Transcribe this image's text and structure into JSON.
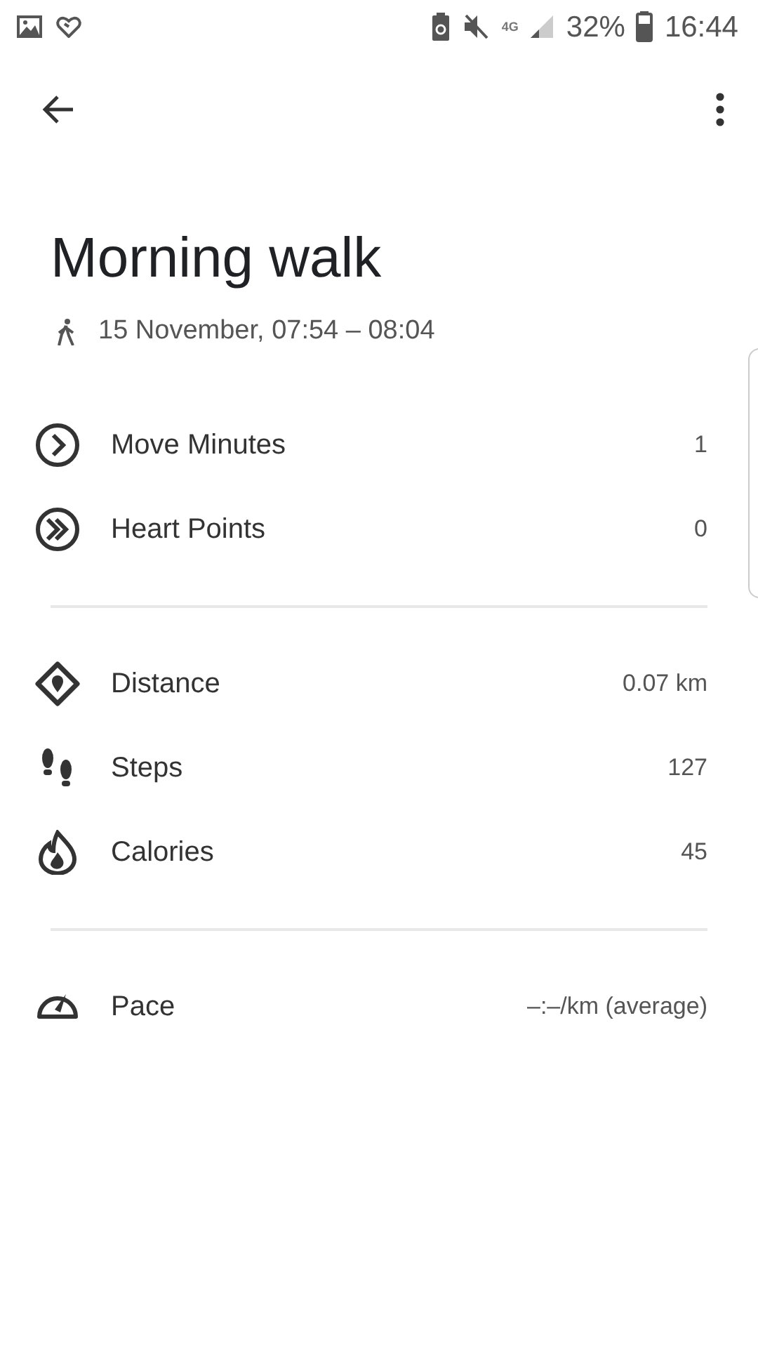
{
  "status_bar": {
    "network": "4G",
    "battery_percent": "32%",
    "time": "16:44"
  },
  "title": "Morning walk",
  "subtitle": {
    "kind": "walk",
    "text": "15 November, 07:54 – 08:04"
  },
  "sections": [
    {
      "rows": [
        {
          "kind": "move",
          "label": "Move Minutes",
          "value": "1"
        },
        {
          "kind": "heart",
          "label": "Heart Points",
          "value": "0"
        }
      ]
    },
    {
      "rows": [
        {
          "kind": "distance",
          "label": "Distance",
          "value": "0.07 km"
        },
        {
          "kind": "steps",
          "label": "Steps",
          "value": "127"
        },
        {
          "kind": "calories",
          "label": "Calories",
          "value": "45"
        }
      ]
    },
    {
      "rows": [
        {
          "kind": "pace",
          "label": "Pace",
          "value": "–:–/km (average)"
        }
      ]
    }
  ]
}
